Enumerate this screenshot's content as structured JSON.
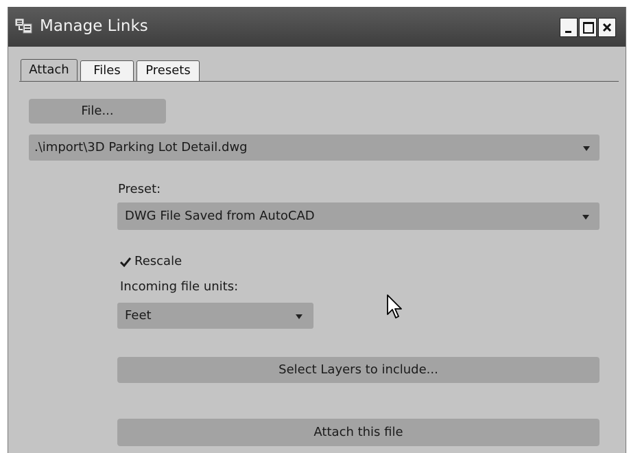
{
  "window": {
    "title": "Manage Links",
    "controls": [
      "minimize",
      "maximize",
      "close"
    ]
  },
  "tabs": [
    {
      "label": "Attach",
      "active": true
    },
    {
      "label": "Files",
      "active": false
    },
    {
      "label": "Presets",
      "active": false
    }
  ],
  "attach": {
    "file_button_label": "File...",
    "file_path": ".\\import\\3D Parking Lot Detail.dwg",
    "preset_label": "Preset:",
    "preset_value": "DWG File Saved from AutoCAD",
    "rescale_label": "Rescale",
    "rescale_checked": true,
    "units_label": "Incoming file units:",
    "units_value": "Feet",
    "select_layers_label": "Select Layers to include...",
    "attach_label": "Attach this file"
  },
  "icons": {
    "app": "manage-links-icon",
    "cursor": "mouse-pointer-icon",
    "dropdown": "dropdown-arrow-icon",
    "check": "checkmark-icon"
  },
  "colors": {
    "titlebar": "#4a4a4a",
    "panel": "#c4c4c4",
    "control": "#a3a3a3"
  }
}
